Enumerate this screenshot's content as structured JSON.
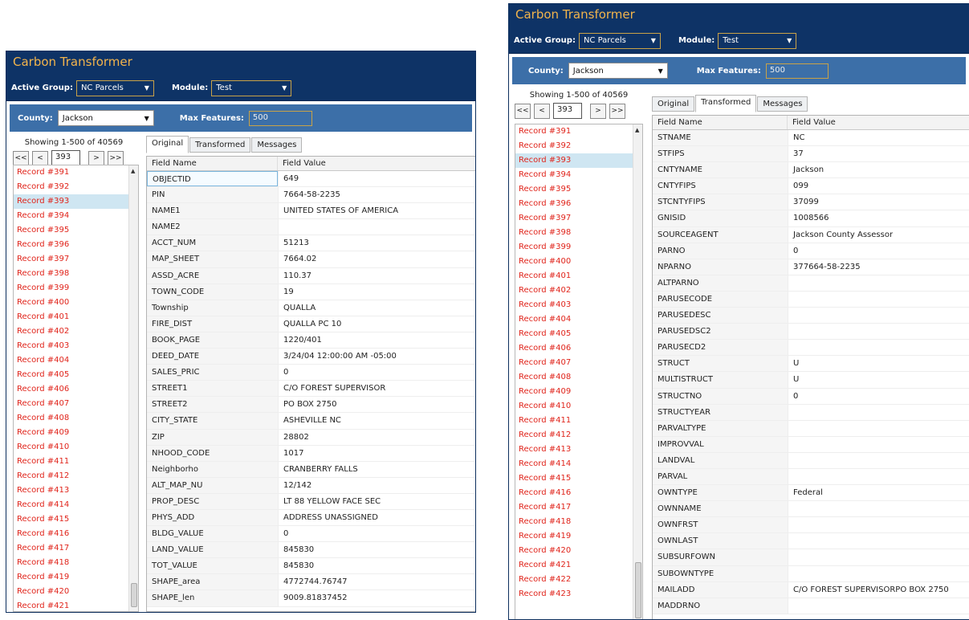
{
  "app": {
    "title": "Carbon Transformer"
  },
  "toolbar": {
    "active_group_label": "Active Group:",
    "active_group_value": "NC Parcels",
    "module_label": "Module:",
    "module_value": "Test"
  },
  "county": {
    "label": "County:",
    "value": "Jackson",
    "max_label": "Max Features:",
    "max_value": "500"
  },
  "pager": {
    "showing": "Showing 1-500 of 40569",
    "first": "<<",
    "prev": "<",
    "page": "393",
    "next": ">",
    "last": ">>"
  },
  "tabs": {
    "original": "Original",
    "transformed": "Transformed",
    "messages": "Messages"
  },
  "grid_headers": {
    "name": "Field Name",
    "value": "Field Value"
  },
  "records_a": [
    "Record #391",
    "Record #392",
    "Record #393",
    "Record #394",
    "Record #395",
    "Record #396",
    "Record #397",
    "Record #398",
    "Record #399",
    "Record #400",
    "Record #401",
    "Record #402",
    "Record #403",
    "Record #404",
    "Record #405",
    "Record #406",
    "Record #407",
    "Record #408",
    "Record #409",
    "Record #410",
    "Record #411",
    "Record #412",
    "Record #413",
    "Record #414",
    "Record #415",
    "Record #416",
    "Record #417",
    "Record #418",
    "Record #419",
    "Record #420",
    "Record #421"
  ],
  "records_b": [
    "Record #391",
    "Record #392",
    "Record #393",
    "Record #394",
    "Record #395",
    "Record #396",
    "Record #397",
    "Record #398",
    "Record #399",
    "Record #400",
    "Record #401",
    "Record #402",
    "Record #403",
    "Record #404",
    "Record #405",
    "Record #406",
    "Record #407",
    "Record #408",
    "Record #409",
    "Record #410",
    "Record #411",
    "Record #412",
    "Record #413",
    "Record #414",
    "Record #415",
    "Record #416",
    "Record #417",
    "Record #418",
    "Record #419",
    "Record #420",
    "Record #421",
    "Record #422",
    "Record #423"
  ],
  "original_fields": [
    [
      "OBJECTID",
      "649"
    ],
    [
      "PIN",
      "7664-58-2235"
    ],
    [
      "NAME1",
      "UNITED STATES OF AMERICA"
    ],
    [
      "NAME2",
      ""
    ],
    [
      "ACCT_NUM",
      "51213"
    ],
    [
      "MAP_SHEET",
      "7664.02"
    ],
    [
      "ASSD_ACRE",
      "110.37"
    ],
    [
      "TOWN_CODE",
      "19"
    ],
    [
      "Township",
      "QUALLA"
    ],
    [
      "FIRE_DIST",
      "QUALLA PC 10"
    ],
    [
      "BOOK_PAGE",
      "1220/401"
    ],
    [
      "DEED_DATE",
      "3/24/04 12:00:00 AM -05:00"
    ],
    [
      "SALES_PRIC",
      "0"
    ],
    [
      "STREET1",
      "C/O FOREST SUPERVISOR"
    ],
    [
      "STREET2",
      "PO BOX 2750"
    ],
    [
      "CITY_STATE",
      "ASHEVILLE NC"
    ],
    [
      "ZIP",
      "28802"
    ],
    [
      "NHOOD_CODE",
      "1017"
    ],
    [
      "Neighborho",
      "CRANBERRY FALLS"
    ],
    [
      "ALT_MAP_NU",
      "12/142"
    ],
    [
      "PROP_DESC",
      "LT 88 YELLOW FACE SEC"
    ],
    [
      "PHYS_ADD",
      "ADDRESS UNASSIGNED"
    ],
    [
      "BLDG_VALUE",
      "0"
    ],
    [
      "LAND_VALUE",
      "845830"
    ],
    [
      "TOT_VALUE",
      "845830"
    ],
    [
      "SHAPE_area",
      "4772744.76747"
    ],
    [
      "SHAPE_len",
      "9009.81837452"
    ]
  ],
  "transformed_fields": [
    [
      "STNAME",
      "NC"
    ],
    [
      "STFIPS",
      "37"
    ],
    [
      "CNTYNAME",
      "Jackson"
    ],
    [
      "CNTYFIPS",
      "099"
    ],
    [
      "STCNTYFIPS",
      "37099"
    ],
    [
      "GNISID",
      "1008566"
    ],
    [
      "SOURCEAGENT",
      "Jackson County Assessor"
    ],
    [
      "PARNO",
      "0"
    ],
    [
      "NPARNO",
      "377664-58-2235"
    ],
    [
      "ALTPARNO",
      ""
    ],
    [
      "PARUSECODE",
      ""
    ],
    [
      "PARUSEDESC",
      ""
    ],
    [
      "PARUSEDSC2",
      ""
    ],
    [
      "PARUSECD2",
      ""
    ],
    [
      "STRUCT",
      "U"
    ],
    [
      "MULTISTRUCT",
      "U"
    ],
    [
      "STRUCTNO",
      "0"
    ],
    [
      "STRUCTYEAR",
      ""
    ],
    [
      "PARVALTYPE",
      ""
    ],
    [
      "IMPROVVAL",
      ""
    ],
    [
      "LANDVAL",
      ""
    ],
    [
      "PARVAL",
      ""
    ],
    [
      "OWNTYPE",
      "Federal"
    ],
    [
      "OWNNAME",
      ""
    ],
    [
      "OWNFRST",
      ""
    ],
    [
      "OWNLAST",
      ""
    ],
    [
      "SUBSURFOWN",
      ""
    ],
    [
      "SUBOWNTYPE",
      ""
    ],
    [
      "MAILADD",
      "C/O FOREST SUPERVISORPO BOX 2750"
    ],
    [
      "MADDRNO",
      ""
    ]
  ]
}
